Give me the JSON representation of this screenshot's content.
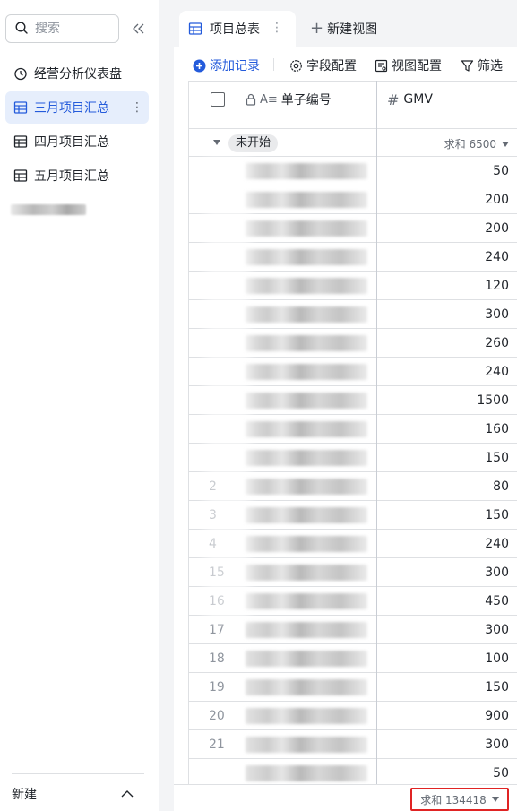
{
  "sidebar": {
    "search_placeholder": "搜索",
    "items": [
      {
        "label": "经营分析仪表盘",
        "icon": "dashboard-icon"
      },
      {
        "label": "三月项目汇总",
        "icon": "table-icon",
        "active": true
      },
      {
        "label": "四月项目汇总",
        "icon": "table-icon"
      },
      {
        "label": "五月项目汇总",
        "icon": "table-icon"
      }
    ],
    "footer_label": "新建"
  },
  "tabs": {
    "active_label": "项目总表",
    "new_view_label": "新建视图"
  },
  "toolbar": {
    "add_record": "添加记录",
    "field_config": "字段配置",
    "view_config": "视图配置",
    "filter": "筛选"
  },
  "table": {
    "columns": [
      {
        "label": "单子编号",
        "icon": "text-field-icon"
      },
      {
        "label": "GMV",
        "icon": "number-field-icon"
      }
    ],
    "group": {
      "label": "未开始",
      "sum_label": "求和 6500"
    },
    "rows": [
      {
        "num": "",
        "gmv": "50"
      },
      {
        "num": "",
        "gmv": "200"
      },
      {
        "num": "",
        "gmv": "200"
      },
      {
        "num": "",
        "gmv": "240"
      },
      {
        "num": "",
        "gmv": "120"
      },
      {
        "num": "",
        "gmv": "300"
      },
      {
        "num": "",
        "gmv": "260"
      },
      {
        "num": "",
        "gmv": "240"
      },
      {
        "num": "",
        "gmv": "1500"
      },
      {
        "num": "",
        "gmv": "160"
      },
      {
        "num": "",
        "gmv": "150"
      },
      {
        "num": "2",
        "gmv": "80"
      },
      {
        "num": "3",
        "gmv": "150"
      },
      {
        "num": "4",
        "gmv": "240"
      },
      {
        "num": "15",
        "gmv": "300"
      },
      {
        "num": "16",
        "gmv": "450"
      },
      {
        "num": "17",
        "gmv": "300"
      },
      {
        "num": "18",
        "gmv": "100"
      },
      {
        "num": "19",
        "gmv": "150"
      },
      {
        "num": "20",
        "gmv": "900"
      },
      {
        "num": "21",
        "gmv": "300"
      },
      {
        "num": "",
        "gmv": "50"
      }
    ],
    "total_label": "求和 134418"
  },
  "colors": {
    "accent": "#245bdb",
    "active_bg": "#e6eefc",
    "highlight_border": "#e02424"
  }
}
